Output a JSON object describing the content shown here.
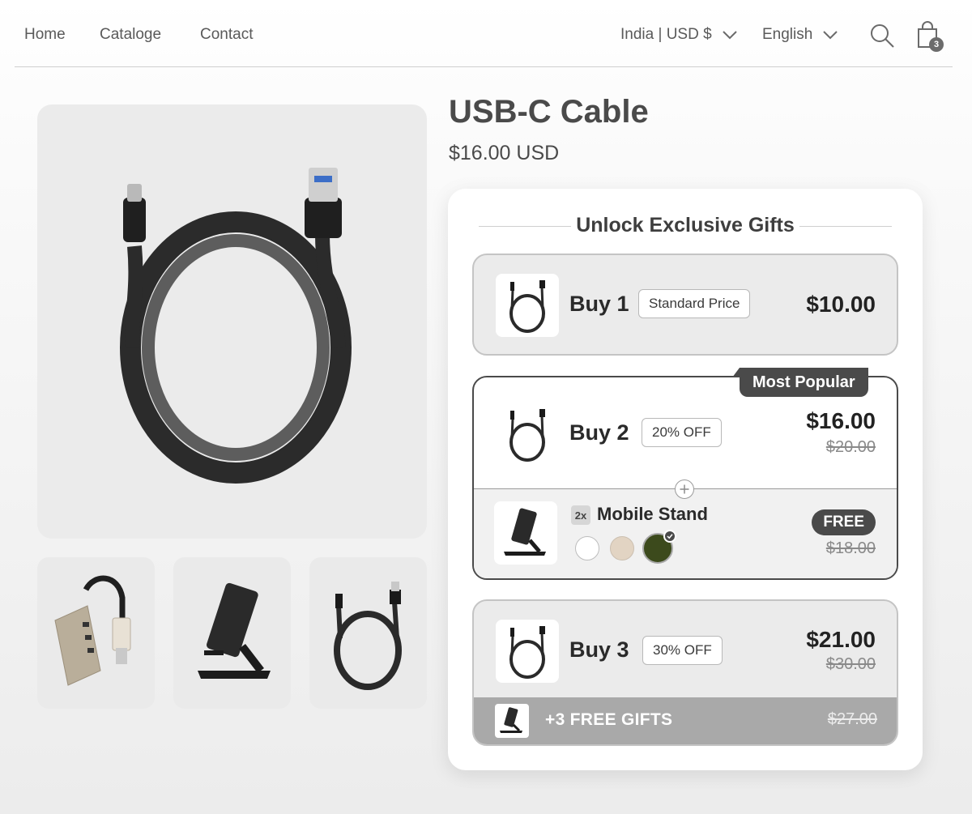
{
  "nav": {
    "links": [
      "Home",
      "Cataloge",
      "Contact"
    ],
    "region": "India | USD $",
    "language": "English",
    "cart_count": "3"
  },
  "product": {
    "title": "USB-C Cable",
    "price": "$16.00 USD"
  },
  "offer": {
    "heading": "Unlock Exclusive Gifts",
    "tiers": [
      {
        "label": "Buy 1",
        "tag": "Standard Price",
        "price": "$10.00"
      },
      {
        "label": "Buy 2",
        "tag": "20% OFF",
        "price": "$16.00",
        "compare_price": "$20.00",
        "badge": "Most Popular",
        "gift": {
          "qty": "2x",
          "name": "Mobile Stand",
          "badge": "FREE",
          "compare_price": "$18.00",
          "swatches": [
            "#ffffff",
            "#e2d4c3",
            "#3c4a1c"
          ],
          "selected_swatch": 2
        }
      },
      {
        "label": "Buy 3",
        "tag": "30% OFF",
        "price": "$21.00",
        "compare_price": "$30.00",
        "gift_bar": {
          "text": "+3 FREE GIFTS",
          "compare_price": "$27.00"
        }
      }
    ]
  },
  "colors": {
    "accent": "#4a4a4a",
    "muted": "#a9a9a9"
  },
  "icons": [
    "chevron-down-icon",
    "search-icon",
    "cart-icon",
    "plus-icon",
    "check-icon"
  ]
}
